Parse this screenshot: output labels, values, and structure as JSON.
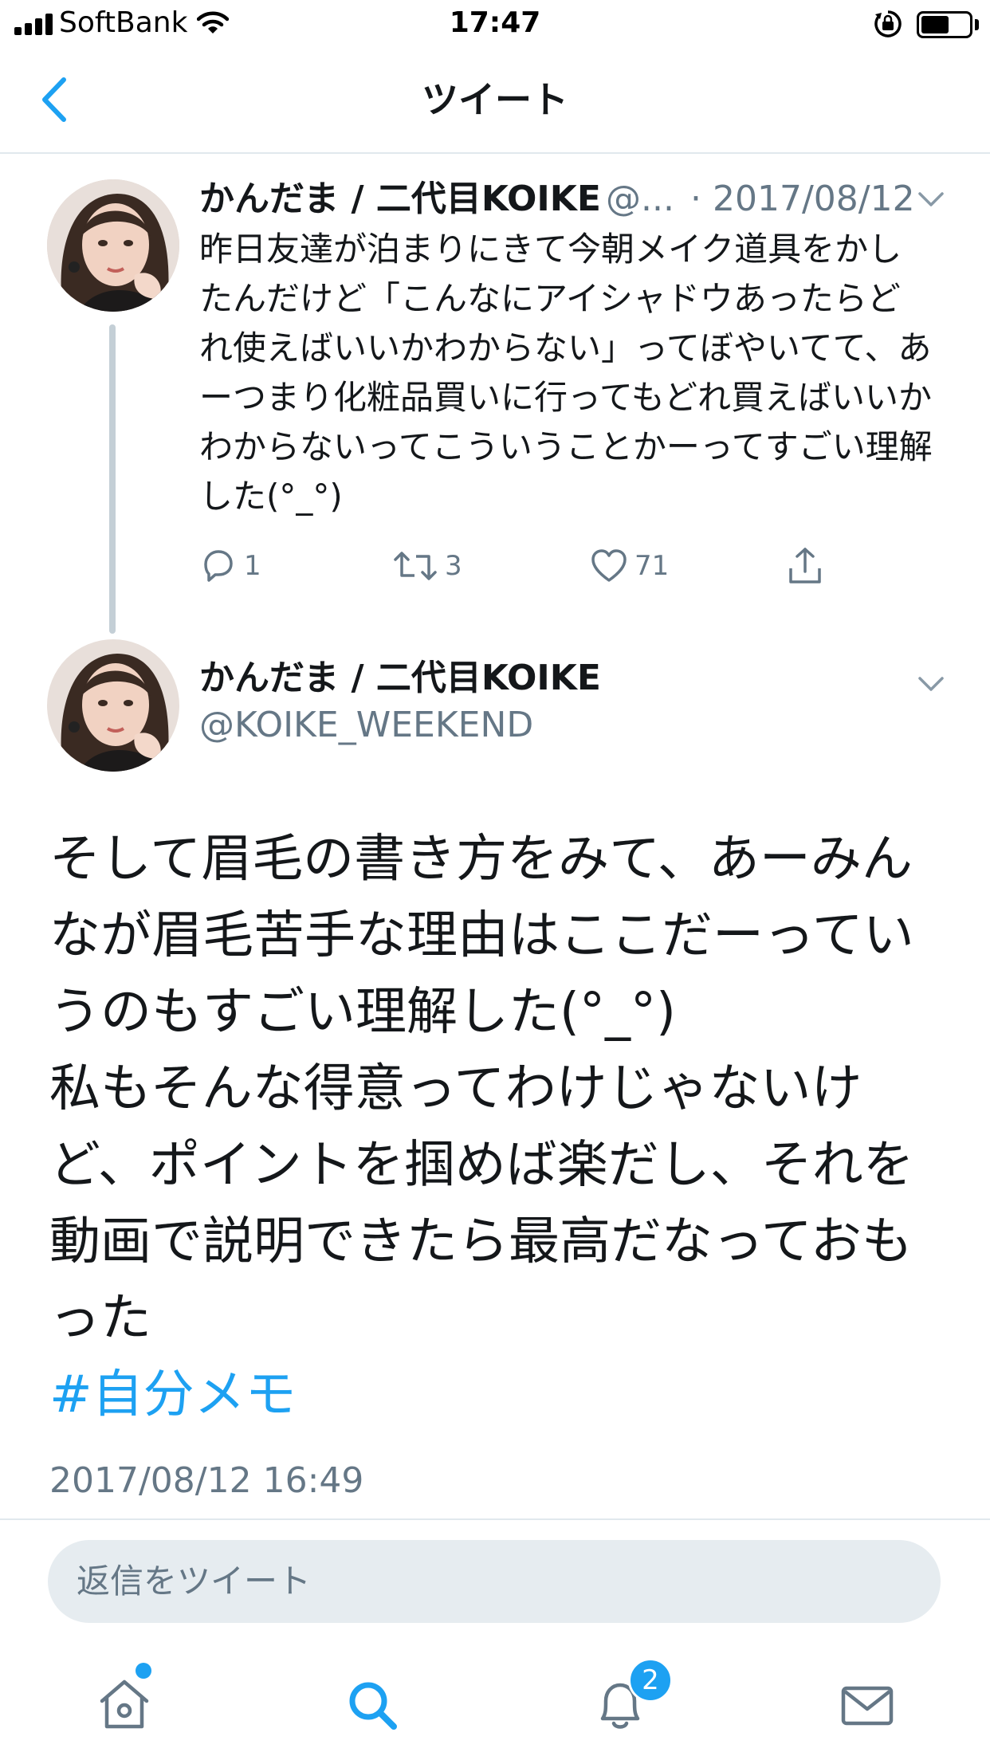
{
  "status_bar": {
    "carrier": "SoftBank",
    "time": "17:47"
  },
  "nav": {
    "title": "ツイート"
  },
  "tweet1": {
    "author_name": "かんだま / 二代目KOIKE",
    "handle_truncated": "@...",
    "date": "· 2017/08/12",
    "text": "昨日友達が泊まりにきて今朝メイク道具をかしたんだけど「こんなにアイシャドウあったらどれ使えばいいかわからない」ってぼやいてて、あーつまり化粧品買いに行ってもどれ買えばいいかわからないってこういうことかーってすごい理解した(°_°)",
    "reply_count": "1",
    "retweet_count": "3",
    "like_count": "71"
  },
  "tweet2": {
    "author_name": "かんだま / 二代目KOIKE",
    "handle": "@KOIKE_WEEKEND",
    "text": "そして眉毛の書き方をみて、あーみんなが眉毛苦手な理由はここだーっていうのもすごい理解した(°_°)\n私もそんな得意ってわけじゃないけど、ポイントを掴めば楽だし、それを動画で説明できたら最高だなっておもった",
    "hashtag": "#自分メモ",
    "timestamp": "2017/08/12 16:49"
  },
  "reply": {
    "placeholder": "返信をツイート"
  },
  "tab_bar": {
    "notification_badge": "2",
    "active_tab": "search"
  },
  "colors": {
    "accent": "#1da1f2",
    "secondary_text": "#657786",
    "divider": "#e1e8ed"
  }
}
